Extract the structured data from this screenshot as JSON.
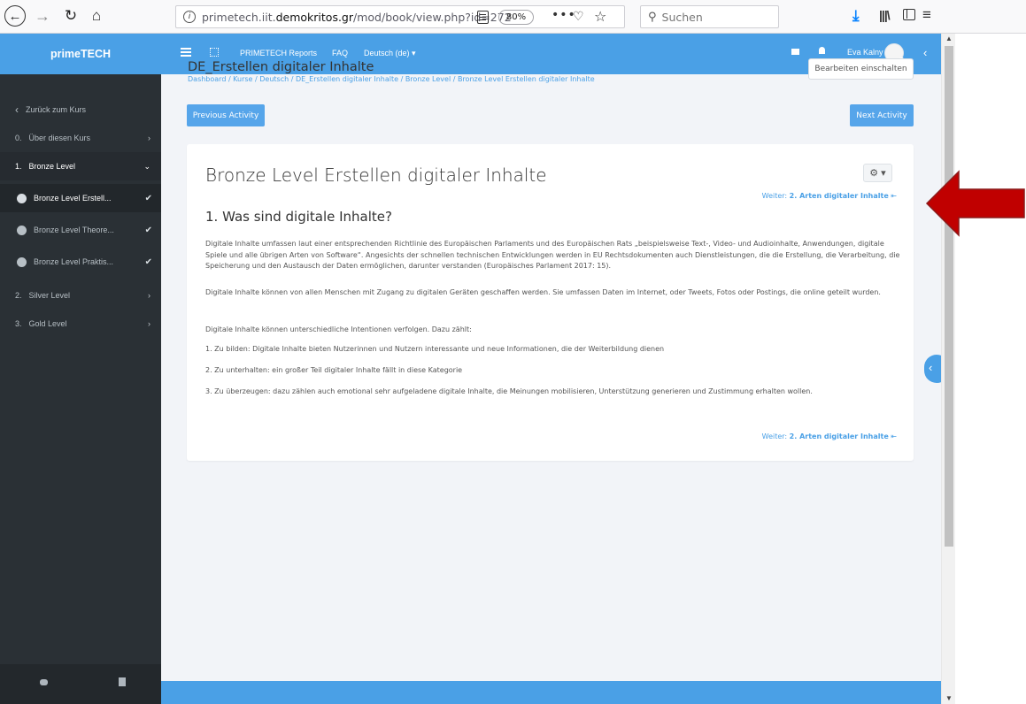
{
  "browser": {
    "url_prefix": "primetech.iit.",
    "url_domain": "demokritos.gr",
    "url_path": "/mod/book/view.php?id=272",
    "zoom": "80%",
    "search_placeholder": "Suchen"
  },
  "topbar": {
    "brand": "primeTECH",
    "links": [
      "PRIMETECH Reports",
      "FAQ",
      "Deutsch (de) ▾"
    ],
    "user_name": "Eva Kalny"
  },
  "sidebar": {
    "items": [
      {
        "label": "Zurück zum Kurs",
        "prefix": "‹"
      },
      {
        "label": "Über diesen Kurs",
        "prefix": "0."
      },
      {
        "label": "Bronze Level",
        "prefix": "1."
      },
      {
        "label": "Bronze Level Erstell..."
      },
      {
        "label": "Bronze Level Theore..."
      },
      {
        "label": "Bronze Level Praktis..."
      },
      {
        "label": "Silver Level",
        "prefix": "2."
      },
      {
        "label": "Gold Level",
        "prefix": "3."
      }
    ]
  },
  "header": {
    "title": "DE_Erstellen digitaler Inhalte",
    "breadcrumb": "Dashboard / Kurse / Deutsch / DE_Erstellen digitaler Inhalte / Bronze Level / Bronze Level Erstellen digitaler Inhalte",
    "edit_button": "Bearbeiten einschalten"
  },
  "activity_nav": {
    "previous": "Previous Activity",
    "next": "Next Activity"
  },
  "book": {
    "title": "Bronze Level Erstellen digitaler Inhalte",
    "next_prefix": "Weiter: ",
    "next_target": "2. Arten digitaler Inhalte",
    "chapter_title": "1. Was sind digitale Inhalte?",
    "paragraphs": [
      "Digitale Inhalte umfassen laut einer entsprechenden Richtlinie des Europäischen Parlaments und des Europäischen Rats „beispielsweise Text-, Video- und Audioinhalte, Anwendungen, digitale Spiele und alle übrigen Arten von Software“. Angesichts der schnellen technischen Entwicklungen werden in EU Rechtsdokumenten auch Dienstleistungen, die die Erstellung, die Verarbeitung, die Speicherung und den Austausch der Daten ermöglichen, darunter verstanden (Europäisches Parlament 2017: 15).",
      "Digitale Inhalte können von allen Menschen mit Zugang zu digitalen Geräten geschaffen werden. Sie umfassen Daten im Internet, oder Tweets, Fotos oder Postings, die online geteilt wurden.",
      "Digitale Inhalte können unterschiedliche Intentionen verfolgen. Dazu zählt:",
      "1. Zu bilden: Digitale Inhalte bieten Nutzerinnen und Nutzern interessante und neue Informationen, die der Weiterbildung dienen",
      "2. Zu unterhalten: ein großer Teil digitaler Inhalte fällt in diese Kategorie",
      "3. Zu überzeugen: dazu zählen auch emotional sehr aufgeladene digitale Inhalte, die Meinungen mobilisieren, Unterstützung generieren und Zustimmung erhalten wollen."
    ]
  },
  "colors": {
    "accent": "#4aa0e6",
    "sidebar": "#2a3035",
    "arrow": "#c00000"
  }
}
